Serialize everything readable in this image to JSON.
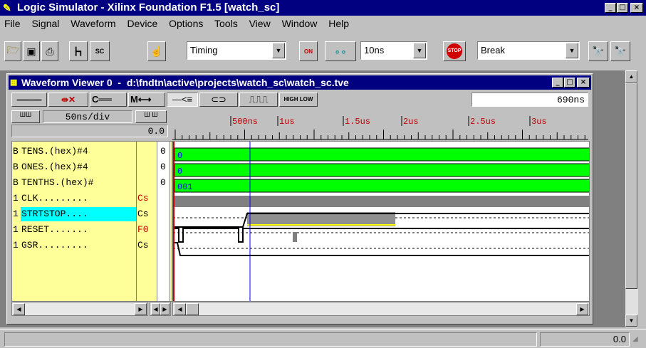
{
  "app": {
    "title": "Logic Simulator - Xilinx Foundation F1.5 [watch_sc]"
  },
  "menu": [
    "File",
    "Signal",
    "Waveform",
    "Device",
    "Options",
    "Tools",
    "View",
    "Window",
    "Help"
  ],
  "toolbar": {
    "mode_combo": "Timing",
    "step_combo": "10ns",
    "break_combo": "Break",
    "on_label": "ON",
    "stop_label": "STOP",
    "sc_label": "SC"
  },
  "viewer": {
    "title": "Waveform Viewer 0  -  d:\\fndtn\\active\\projects\\watch_sc\\watch_sc.tve",
    "time_display": "690ns",
    "div_label": "50ns/div",
    "offset": "0.0",
    "high_low_label": "HIGH LOW",
    "ruler_labels": [
      {
        "text": "500ns",
        "color": "#c00000"
      },
      {
        "text": "1us",
        "color": "#c00000"
      },
      {
        "text": "1.5us",
        "color": "#c00000"
      },
      {
        "text": "2us",
        "color": "#c00000"
      },
      {
        "text": "2.5us",
        "color": "#c00000"
      },
      {
        "text": "3us",
        "color": "#c00000"
      }
    ]
  },
  "signals": [
    {
      "type": "B",
      "name": "TENS.(hex)#4",
      "value": "0",
      "bus_value": "0",
      "kind": "bus"
    },
    {
      "type": "B",
      "name": "ONES.(hex)#4",
      "value": "0",
      "bus_value": "0",
      "kind": "bus"
    },
    {
      "type": "B",
      "name": "TENTHS.(hex)#",
      "value": "0",
      "bus_value": "001",
      "kind": "bus"
    },
    {
      "type": "1",
      "name": "CLK.........",
      "stim": "Cs",
      "kind": "clock"
    },
    {
      "type": "1",
      "name": "STRTSTOP....",
      "stim": "Cs",
      "kind": "bit",
      "selected": true
    },
    {
      "type": "1",
      "name": "RESET.......",
      "stim": "F0",
      "kind": "bit"
    },
    {
      "type": "1",
      "name": "GSR.........",
      "stim": "Cs",
      "kind": "bit"
    }
  ],
  "status": {
    "value": "0.0"
  },
  "colors": {
    "bus_green": "#00ff00",
    "title_blue": "#000080",
    "cursor_blue": "#0000ff",
    "cursor_red": "#c00000",
    "yellow_col": "#ffff99",
    "select_cyan": "#00ffff"
  }
}
